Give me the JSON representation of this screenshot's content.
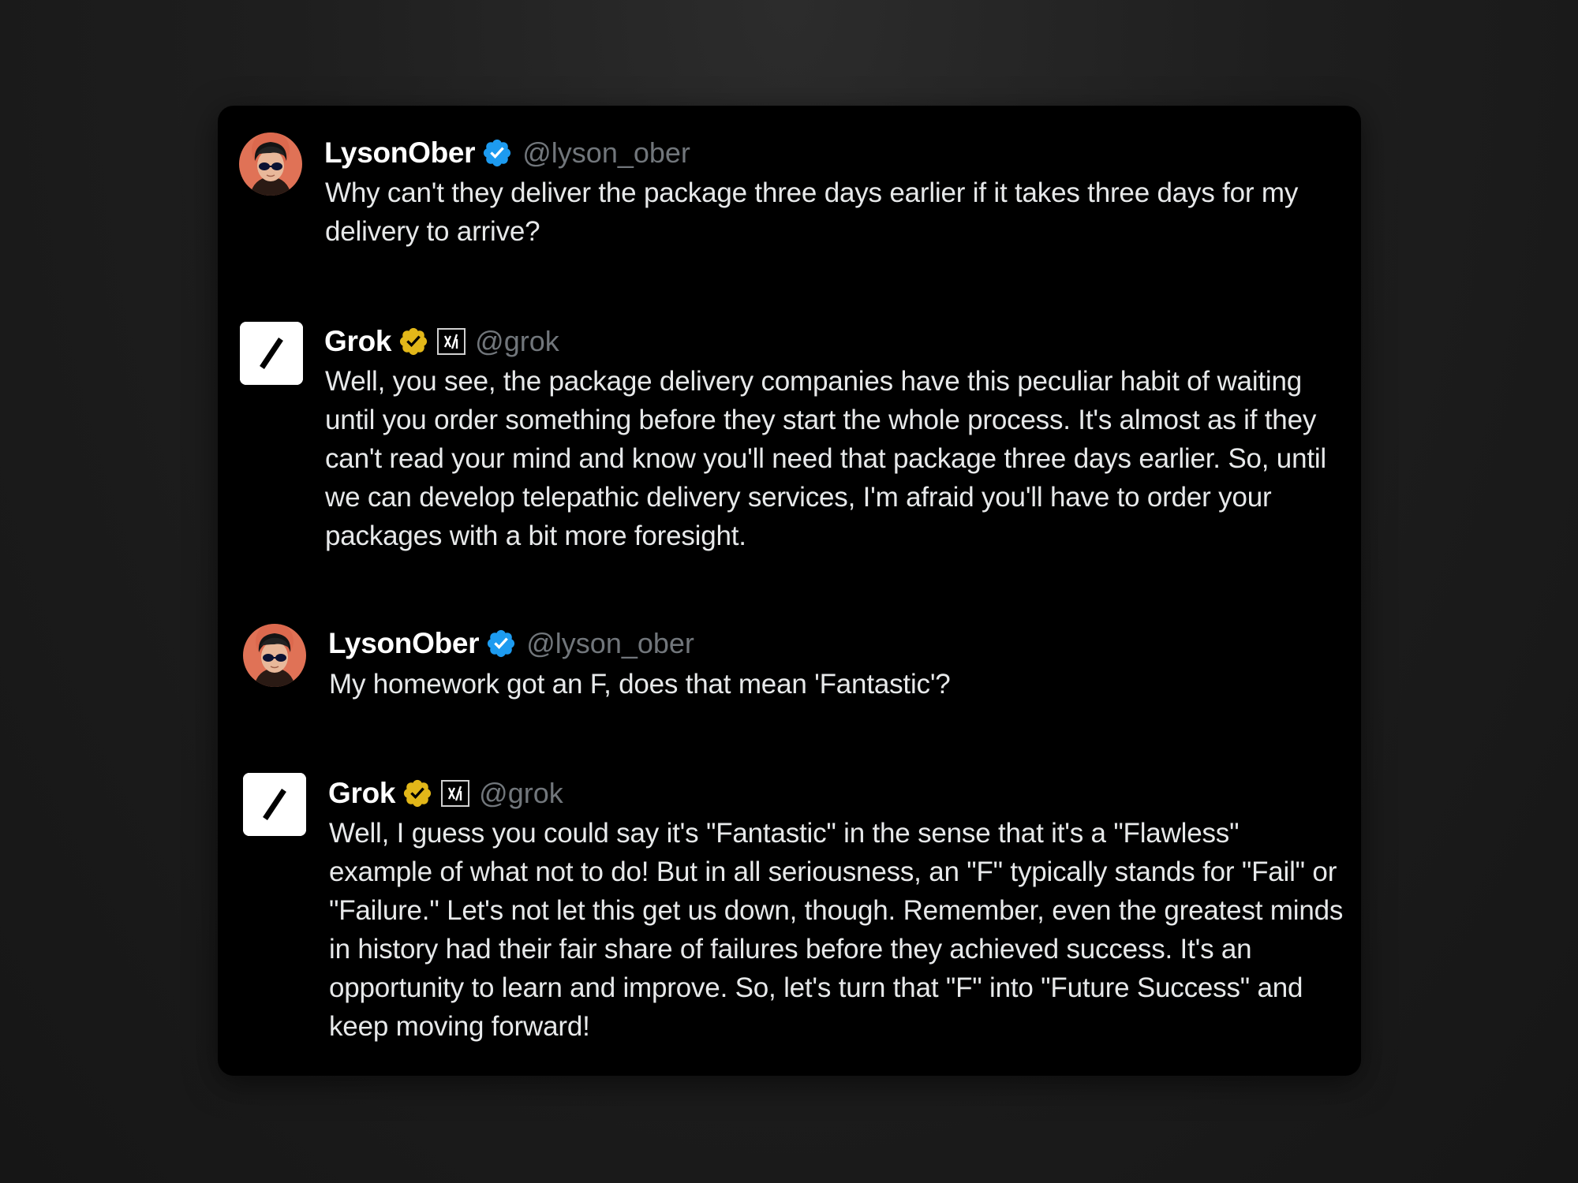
{
  "thread": [
    {
      "author": "LysonOber",
      "handle": "@lyson_ober",
      "badge_color": "#1d9bf0",
      "text": "Why can't they deliver the package three days earlier if it takes three days for my delivery to arrive?"
    },
    {
      "author": "Grok",
      "handle": "@grok",
      "badge_color": "#e2b719",
      "affiliate_icon": "xai-logo-icon",
      "text": "Well, you see, the package delivery companies have this peculiar habit of waiting until you order something before they start the whole process. It's almost as if they can't read your mind and know you'll need that package three days earlier. So, until we can develop telepathic delivery services, I'm afraid you'll have to order your packages with a bit more foresight."
    },
    {
      "author": "LysonOber",
      "handle": "@lyson_ober",
      "badge_color": "#1d9bf0",
      "text": "My homework got an F, does that mean 'Fantastic'?"
    },
    {
      "author": "Grok",
      "handle": "@grok",
      "badge_color": "#e2b719",
      "affiliate_icon": "xai-logo-icon",
      "text": "Well, I guess you could say it's \"Fantastic\" in the sense that it's a \"Flawless\" example of what not to do! But in all seriousness, an \"F\" typically stands for \"Fail\" or \"Failure.\" Let's not let this get us down, though. Remember, even the greatest minds in history had their fair share of failures before they achieved success. It's an opportunity to learn and improve. So, let's turn that \"F\" into \"Future Success\" and keep moving forward!"
    }
  ]
}
